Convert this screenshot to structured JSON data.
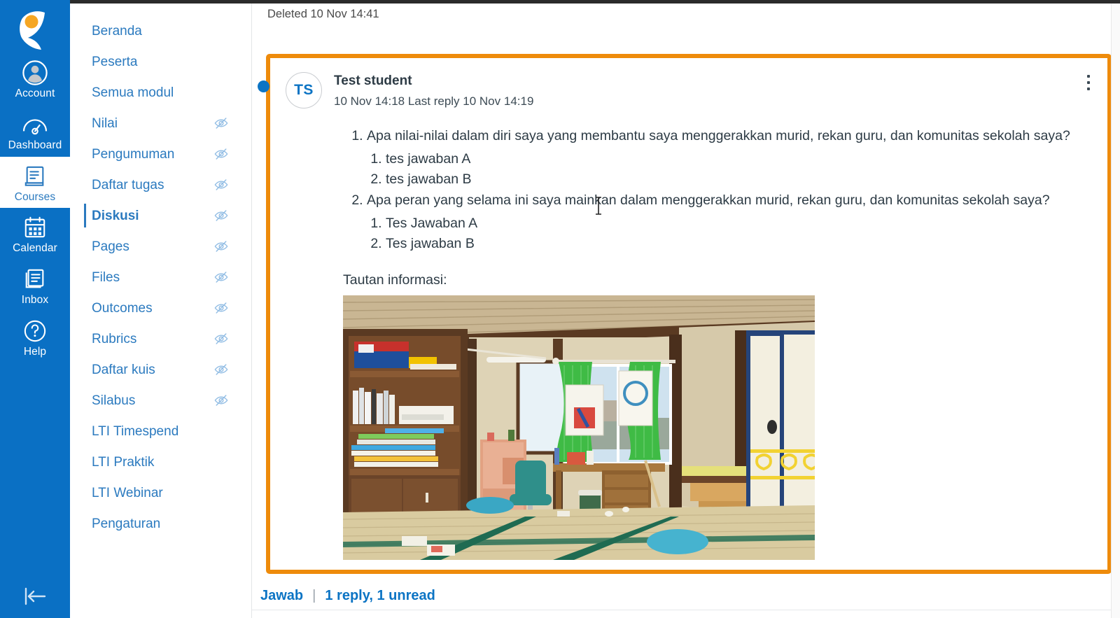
{
  "global_nav": {
    "logo_name": "canvas-logo",
    "items": [
      {
        "label": "Account",
        "icon": "user-circle-icon",
        "active": false
      },
      {
        "label": "Dashboard",
        "icon": "dashboard-icon",
        "active": false
      },
      {
        "label": "Courses",
        "icon": "courses-book-icon",
        "active": true
      },
      {
        "label": "Calendar",
        "icon": "calendar-icon",
        "active": false
      },
      {
        "label": "Inbox",
        "icon": "inbox-icon",
        "active": false
      },
      {
        "label": "Help",
        "icon": "question-mark-icon",
        "active": false
      }
    ],
    "collapse_icon": "collapse-left-arrow-icon"
  },
  "course_nav": {
    "items": [
      {
        "label": "Beranda",
        "hidden_icon": false,
        "active": false
      },
      {
        "label": "Peserta",
        "hidden_icon": false,
        "active": false
      },
      {
        "label": "Semua modul",
        "hidden_icon": false,
        "active": false
      },
      {
        "label": "Nilai",
        "hidden_icon": true,
        "active": false
      },
      {
        "label": "Pengumuman",
        "hidden_icon": true,
        "active": false
      },
      {
        "label": "Daftar tugas",
        "hidden_icon": true,
        "active": false
      },
      {
        "label": "Diskusi",
        "hidden_icon": true,
        "active": true
      },
      {
        "label": "Pages",
        "hidden_icon": true,
        "active": false
      },
      {
        "label": "Files",
        "hidden_icon": true,
        "active": false
      },
      {
        "label": "Outcomes",
        "hidden_icon": true,
        "active": false
      },
      {
        "label": "Rubrics",
        "hidden_icon": true,
        "active": false
      },
      {
        "label": "Daftar kuis",
        "hidden_icon": true,
        "active": false
      },
      {
        "label": "Silabus",
        "hidden_icon": true,
        "active": false
      },
      {
        "label": "LTI Timespend",
        "hidden_icon": false,
        "active": false
      },
      {
        "label": "LTI Praktik",
        "hidden_icon": false,
        "active": false
      },
      {
        "label": "LTI Webinar",
        "hidden_icon": false,
        "active": false
      },
      {
        "label": "Pengaturan",
        "hidden_icon": false,
        "active": false
      }
    ],
    "hidden_icon_name": "eye-slash-icon"
  },
  "main": {
    "deleted_note": "Deleted 10 Nov 14:41",
    "entry": {
      "unread_indicator": "unread-dot",
      "avatar_initials": "TS",
      "author": "Test student",
      "timestamps": "10 Nov 14:18  Last reply 10 Nov 14:19",
      "kebab_menu": "more-options-icon",
      "highlight_color": "#ee8b0b",
      "list": [
        {
          "text": "Apa nilai-nilai dalam diri saya yang membantu saya menggerakkan murid, rekan guru, dan komunitas sekolah saya?",
          "sub": [
            "tes jawaban A",
            "tes jawaban B"
          ]
        },
        {
          "text": "Apa peran yang selama ini saya mainkan dalam menggerakkan murid, rekan guru, dan komunitas sekolah saya?",
          "sub": [
            "Tes Jawaban A",
            "Tes jawaban B"
          ]
        }
      ],
      "link_label": "Tautan informasi:",
      "embedded_image": "japanese-tatami-room-illustration"
    },
    "reply_bar": {
      "reply_label": "Jawab",
      "separator": "|",
      "count_label": "1 reply, 1 unread"
    }
  },
  "colors": {
    "global_nav_blue": "#0a70c4",
    "link_blue": "#2b7abf",
    "highlight_orange": "#ee8b0b",
    "text_dark": "#2d3b45"
  }
}
